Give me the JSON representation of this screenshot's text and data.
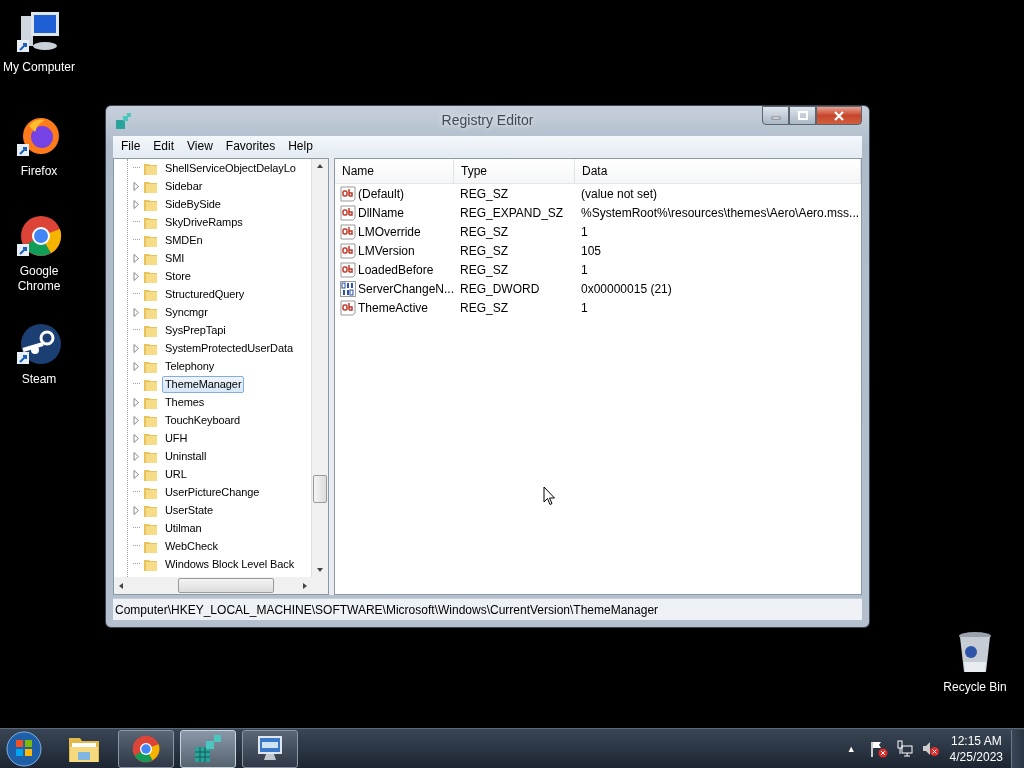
{
  "desktop_icons": [
    {
      "kind": "computer",
      "label": "My Computer"
    },
    {
      "kind": "firefox",
      "label": "Firefox"
    },
    {
      "kind": "chrome",
      "label": "Google Chrome"
    },
    {
      "kind": "steam",
      "label": "Steam"
    },
    {
      "kind": "recycle",
      "label": "Recycle Bin"
    }
  ],
  "window": {
    "title": "Registry Editor",
    "menu": [
      "File",
      "Edit",
      "View",
      "Favorites",
      "Help"
    ],
    "tree": [
      {
        "label": "ShellServiceObjectDelayLo",
        "expandable": false,
        "selected": false
      },
      {
        "label": "Sidebar",
        "expandable": true,
        "selected": false
      },
      {
        "label": "SideBySide",
        "expandable": true,
        "selected": false
      },
      {
        "label": "SkyDriveRamps",
        "expandable": false,
        "selected": false
      },
      {
        "label": "SMDEn",
        "expandable": false,
        "selected": false
      },
      {
        "label": "SMI",
        "expandable": true,
        "selected": false
      },
      {
        "label": "Store",
        "expandable": true,
        "selected": false
      },
      {
        "label": "StructuredQuery",
        "expandable": false,
        "selected": false
      },
      {
        "label": "Syncmgr",
        "expandable": true,
        "selected": false
      },
      {
        "label": "SysPrepTapi",
        "expandable": false,
        "selected": false
      },
      {
        "label": "SystemProtectedUserData",
        "expandable": true,
        "selected": false
      },
      {
        "label": "Telephony",
        "expandable": true,
        "selected": false
      },
      {
        "label": "ThemeManager",
        "expandable": false,
        "selected": true
      },
      {
        "label": "Themes",
        "expandable": true,
        "selected": false
      },
      {
        "label": "TouchKeyboard",
        "expandable": true,
        "selected": false
      },
      {
        "label": "UFH",
        "expandable": true,
        "selected": false
      },
      {
        "label": "Uninstall",
        "expandable": true,
        "selected": false
      },
      {
        "label": "URL",
        "expandable": true,
        "selected": false
      },
      {
        "label": "UserPictureChange",
        "expandable": false,
        "selected": false
      },
      {
        "label": "UserState",
        "expandable": true,
        "selected": false
      },
      {
        "label": "Utilman",
        "expandable": false,
        "selected": false
      },
      {
        "label": "WebCheck",
        "expandable": false,
        "selected": false
      },
      {
        "label": "Windows Block Level Back",
        "expandable": false,
        "selected": false
      }
    ],
    "table": {
      "columns": [
        "Name",
        "Type",
        "Data"
      ],
      "rows": [
        {
          "kind": "string",
          "name": "(Default)",
          "type": "REG_SZ",
          "data": "(value not set)"
        },
        {
          "kind": "string",
          "name": "DllName",
          "type": "REG_EXPAND_SZ",
          "data": "%SystemRoot%\\resources\\themes\\Aero\\Aero.mss..."
        },
        {
          "kind": "string",
          "name": "LMOverride",
          "type": "REG_SZ",
          "data": "1"
        },
        {
          "kind": "string",
          "name": "LMVersion",
          "type": "REG_SZ",
          "data": "105"
        },
        {
          "kind": "string",
          "name": "LoadedBefore",
          "type": "REG_SZ",
          "data": "1"
        },
        {
          "kind": "binary",
          "name": "ServerChangeN...",
          "type": "REG_DWORD",
          "data": "0x00000015 (21)"
        },
        {
          "kind": "string",
          "name": "ThemeActive",
          "type": "REG_SZ",
          "data": "1"
        }
      ]
    },
    "status_bar": "Computer\\HKEY_LOCAL_MACHINE\\SOFTWARE\\Microsoft\\Windows\\CurrentVersion\\ThemeManager"
  },
  "taskbar": {
    "items": [
      {
        "kind": "explorer",
        "running": false,
        "selected": false
      },
      {
        "kind": "chrome",
        "running": true,
        "selected": false
      },
      {
        "kind": "regedit",
        "running": true,
        "selected": true
      },
      {
        "kind": "remote",
        "running": true,
        "selected": false
      }
    ],
    "tray_arrow": "▲",
    "time": "12:15 AM",
    "date": "4/25/2023"
  }
}
